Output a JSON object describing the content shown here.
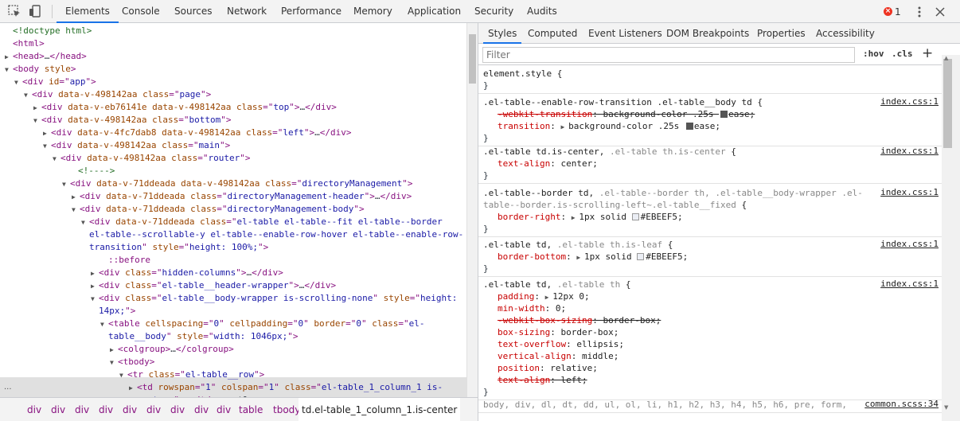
{
  "toolbar": {
    "tabs": [
      "Elements",
      "Console",
      "Sources",
      "Network",
      "Performance",
      "Memory",
      "Application",
      "Security",
      "Audits"
    ],
    "active_tab": "Elements",
    "error_count": "1",
    "icons": [
      "inspect-element-icon",
      "device-toggle-icon",
      "error-icon",
      "kebab-menu-icon",
      "close-icon"
    ]
  },
  "dom_lines": [
    {
      "parts": [
        [
          "cm",
          "<!doctype html>"
        ]
      ]
    },
    {
      "parts": [
        [
          "tag",
          "<html>"
        ]
      ]
    },
    {
      "tri": "▶",
      "parts": [
        [
          "tag",
          "<head>"
        ],
        [
          "plain",
          "…"
        ],
        [
          "tag",
          "</head>"
        ]
      ]
    },
    {
      "tri": "▼",
      "parts": [
        [
          "tag",
          "<body"
        ],
        [
          "an",
          " style"
        ],
        [
          "tag",
          ">"
        ]
      ]
    },
    {
      "tri": "▼",
      "parts": [
        [
          "tag",
          "<div"
        ],
        [
          "an",
          " id"
        ],
        [
          "tag",
          "=\""
        ],
        [
          "av",
          "app"
        ],
        [
          "tag",
          "\">"
        ]
      ]
    },
    {
      "tri": "▼",
      "parts": [
        [
          "tag",
          "<div"
        ],
        [
          "an",
          " data-v-498142aa class"
        ],
        [
          "tag",
          "=\""
        ],
        [
          "av",
          "page"
        ],
        [
          "tag",
          "\">"
        ]
      ]
    },
    {
      "tri": "▶",
      "parts": [
        [
          "tag",
          "<div"
        ],
        [
          "an",
          " data-v-eb76141e data-v-498142aa class"
        ],
        [
          "tag",
          "=\""
        ],
        [
          "av",
          "top"
        ],
        [
          "tag",
          "\">"
        ],
        [
          "plain",
          "…"
        ],
        [
          "tag",
          "</div>"
        ]
      ]
    },
    {
      "tri": "▼",
      "parts": [
        [
          "tag",
          "<div"
        ],
        [
          "an",
          " data-v-498142aa class"
        ],
        [
          "tag",
          "=\""
        ],
        [
          "av",
          "bottom"
        ],
        [
          "tag",
          "\">"
        ]
      ]
    },
    {
      "tri": "▶",
      "parts": [
        [
          "tag",
          "<div"
        ],
        [
          "an",
          " data-v-4fc7dab8 data-v-498142aa class"
        ],
        [
          "tag",
          "=\""
        ],
        [
          "av",
          "left"
        ],
        [
          "tag",
          "\">"
        ],
        [
          "plain",
          "…"
        ],
        [
          "tag",
          "</div>"
        ]
      ]
    },
    {
      "tri": "▼",
      "parts": [
        [
          "tag",
          "<div"
        ],
        [
          "an",
          " data-v-498142aa class"
        ],
        [
          "tag",
          "=\""
        ],
        [
          "av",
          "main"
        ],
        [
          "tag",
          "\">"
        ]
      ]
    },
    {
      "tri": "▼",
      "parts": [
        [
          "tag",
          "<div"
        ],
        [
          "an",
          " data-v-498142aa class"
        ],
        [
          "tag",
          "=\""
        ],
        [
          "av",
          "router"
        ],
        [
          "tag",
          "\">"
        ]
      ]
    },
    {
      "parts": [
        [
          "cm",
          "<!---->"
        ]
      ]
    },
    {
      "tri": "▼",
      "parts": [
        [
          "tag",
          "<div"
        ],
        [
          "an",
          " data-v-71ddeada data-v-498142aa class"
        ],
        [
          "tag",
          "=\""
        ],
        [
          "av",
          "directoryManagement"
        ],
        [
          "tag",
          "\">"
        ]
      ]
    },
    {
      "tri": "▶",
      "parts": [
        [
          "tag",
          "<div"
        ],
        [
          "an",
          " data-v-71ddeada class"
        ],
        [
          "tag",
          "=\""
        ],
        [
          "av",
          "directoryManagement-header"
        ],
        [
          "tag",
          "\">"
        ],
        [
          "plain",
          "…"
        ],
        [
          "tag",
          "</div>"
        ]
      ]
    },
    {
      "tri": "▼",
      "parts": [
        [
          "tag",
          "<div"
        ],
        [
          "an",
          " data-v-71ddeada class"
        ],
        [
          "tag",
          "=\""
        ],
        [
          "av",
          "directoryManagement-body"
        ],
        [
          "tag",
          "\">"
        ]
      ]
    },
    {
      "tri": "▼",
      "parts": [
        [
          "tag",
          "<div"
        ],
        [
          "an",
          " data-v-71ddeada class"
        ],
        [
          "tag",
          "=\""
        ],
        [
          "av",
          "el-table el-table--fit el-table--border"
        ]
      ]
    },
    {
      "parts": [
        [
          "av",
          "el-table--scrollable-y el-table--enable-row-hover el-table--enable-row-"
        ]
      ]
    },
    {
      "parts": [
        [
          "av",
          "transition"
        ],
        [
          "tag",
          "\""
        ],
        [
          "an",
          " style"
        ],
        [
          "tag",
          "=\""
        ],
        [
          "av",
          "height: 100%;"
        ],
        [
          "tag",
          "\">"
        ]
      ]
    },
    {
      "parts": [
        [
          "pseudo",
          "::before"
        ]
      ]
    },
    {
      "tri": "▶",
      "parts": [
        [
          "tag",
          "<div"
        ],
        [
          "an",
          " class"
        ],
        [
          "tag",
          "=\""
        ],
        [
          "av",
          "hidden-columns"
        ],
        [
          "tag",
          "\">"
        ],
        [
          "plain",
          "…"
        ],
        [
          "tag",
          "</div>"
        ]
      ]
    },
    {
      "tri": "▶",
      "parts": [
        [
          "tag",
          "<div"
        ],
        [
          "an",
          " class"
        ],
        [
          "tag",
          "=\""
        ],
        [
          "av",
          "el-table__header-wrapper"
        ],
        [
          "tag",
          "\">"
        ],
        [
          "plain",
          "…"
        ],
        [
          "tag",
          "</div>"
        ]
      ]
    },
    {
      "tri": "▼",
      "parts": [
        [
          "tag",
          "<div"
        ],
        [
          "an",
          " class"
        ],
        [
          "tag",
          "=\""
        ],
        [
          "av",
          "el-table__body-wrapper is-scrolling-none"
        ],
        [
          "tag",
          "\""
        ],
        [
          "an",
          " style"
        ],
        [
          "tag",
          "=\""
        ],
        [
          "av",
          "height:"
        ]
      ]
    },
    {
      "parts": [
        [
          "av",
          "14px;"
        ],
        [
          "tag",
          "\">"
        ]
      ]
    },
    {
      "tri": "▼",
      "parts": [
        [
          "tag",
          "<table"
        ],
        [
          "an",
          " cellspacing"
        ],
        [
          "tag",
          "=\""
        ],
        [
          "av",
          "0"
        ],
        [
          "tag",
          "\""
        ],
        [
          "an",
          " cellpadding"
        ],
        [
          "tag",
          "=\""
        ],
        [
          "av",
          "0"
        ],
        [
          "tag",
          "\""
        ],
        [
          "an",
          " border"
        ],
        [
          "tag",
          "=\""
        ],
        [
          "av",
          "0"
        ],
        [
          "tag",
          "\""
        ],
        [
          "an",
          " class"
        ],
        [
          "tag",
          "=\""
        ],
        [
          "av",
          "el-"
        ]
      ]
    },
    {
      "parts": [
        [
          "av",
          "table__body"
        ],
        [
          "tag",
          "\""
        ],
        [
          "an",
          " style"
        ],
        [
          "tag",
          "=\""
        ],
        [
          "av",
          "width: 1046px;"
        ],
        [
          "tag",
          "\">"
        ]
      ]
    },
    {
      "tri": "▶",
      "parts": [
        [
          "tag",
          "<colgroup>"
        ],
        [
          "plain",
          "…"
        ],
        [
          "tag",
          "</colgroup>"
        ]
      ]
    },
    {
      "tri": "▼",
      "parts": [
        [
          "tag",
          "<tbody>"
        ]
      ]
    },
    {
      "tri": "▼",
      "parts": [
        [
          "tag",
          "<tr"
        ],
        [
          "an",
          " class"
        ],
        [
          "tag",
          "=\""
        ],
        [
          "av",
          "el-table__row"
        ],
        [
          "tag",
          "\">"
        ]
      ]
    },
    {
      "tri": "▶",
      "parts": [
        [
          "tag",
          "<td"
        ],
        [
          "an",
          " rowspan"
        ],
        [
          "tag",
          "=\""
        ],
        [
          "av",
          "1"
        ],
        [
          "tag",
          "\""
        ],
        [
          "an",
          " colspan"
        ],
        [
          "tag",
          "=\""
        ],
        [
          "av",
          "1"
        ],
        [
          "tag",
          "\""
        ],
        [
          "an",
          " class"
        ],
        [
          "tag",
          "=\""
        ],
        [
          "av",
          "el-table_1_column_1 is-"
        ]
      ]
    },
    {
      "parts": [
        [
          "av",
          "center "
        ],
        [
          "tag",
          "\">"
        ],
        [
          "plain",
          "…"
        ],
        [
          "tag",
          "</td>"
        ],
        [
          "plain",
          " == $0"
        ]
      ]
    }
  ],
  "breadcrumbs": [
    "div",
    "div",
    "div",
    "div",
    "div",
    "div",
    "div",
    "div",
    "div",
    "table",
    "tbody",
    "tr",
    "td.el-table_1_column_1.is-center"
  ],
  "breadcrumb_dots": "...",
  "side_tabs": [
    "Styles",
    "Computed",
    "Event Listeners",
    "DOM Breakpoints",
    "Properties",
    "Accessibility"
  ],
  "active_side_tab": "Styles",
  "filter": {
    "placeholder": "Filter",
    "hov": ":hov",
    "cls": ".cls",
    "plus": "+"
  },
  "rules": [
    {
      "selector": [
        [
          "sel",
          "element.style {"
        ]
      ],
      "src": "",
      "props": [],
      "close": "}"
    },
    {
      "selector": [
        [
          "sel",
          ".el-table--enable-row-transition .el-table__body td {"
        ]
      ],
      "src": "index.css:1",
      "props": [
        {
          "name": "-webkit-transition",
          "value": "background-color .25s ease;",
          "strike": true,
          "ease": true
        },
        {
          "name": "transition",
          "value": "background-color .25s ease;",
          "strike": false,
          "tri": true,
          "ease": true
        }
      ],
      "close": "}"
    },
    {
      "selector": [
        [
          "sel",
          ".el-table td.is-center, "
        ],
        [
          "sel-dim",
          ".el-table th.is-center"
        ],
        [
          "sel",
          " {"
        ]
      ],
      "src": "index.css:1",
      "props": [
        {
          "name": "text-align",
          "value": "center;",
          "strike": false
        }
      ],
      "close": "}"
    },
    {
      "selector": [
        [
          "sel",
          ".el-table--border td, "
        ],
        [
          "sel-dim",
          ".el-table--border th, .el-table__body-wrapper .el-"
        ]
      ],
      "selector2": [
        [
          "sel-dim",
          "table--border.is-scrolling-left~.el-table__fixed"
        ],
        [
          "sel",
          " {"
        ]
      ],
      "src": "index.css:1",
      "props": [
        {
          "name": "border-right",
          "value": "1px solid #EBEEF5;",
          "strike": false,
          "tri": true,
          "swatch": "#EBEEF5"
        }
      ],
      "close": "}"
    },
    {
      "selector": [
        [
          "sel",
          ".el-table td, "
        ],
        [
          "sel-dim",
          ".el-table th.is-leaf"
        ],
        [
          "sel",
          " {"
        ]
      ],
      "src": "index.css:1",
      "props": [
        {
          "name": "border-bottom",
          "value": "1px solid #EBEEF5;",
          "strike": false,
          "tri": true,
          "swatch": "#EBEEF5"
        }
      ],
      "close": "}"
    },
    {
      "selector": [
        [
          "sel",
          ".el-table td, "
        ],
        [
          "sel-dim",
          ".el-table th"
        ],
        [
          "sel",
          " {"
        ]
      ],
      "src": "index.css:1",
      "props": [
        {
          "name": "padding",
          "value": "12px 0;",
          "strike": false,
          "tri": true
        },
        {
          "name": "min-width",
          "value": "0;",
          "strike": false
        },
        {
          "name": "-webkit-box-sizing",
          "value": "border-box;",
          "strike": true
        },
        {
          "name": "box-sizing",
          "value": "border-box;",
          "strike": false
        },
        {
          "name": "text-overflow",
          "value": "ellipsis;",
          "strike": false
        },
        {
          "name": "vertical-align",
          "value": "middle;",
          "strike": false
        },
        {
          "name": "position",
          "value": "relative;",
          "strike": false
        },
        {
          "name": "text-align",
          "value": "left;",
          "strike": true
        }
      ],
      "close": "}"
    },
    {
      "selector": [
        [
          "sel-dim",
          "body, div, dl, dt, dd, ul, ol, li, h1, h2, h3, h4, h5, h6, pre, form,"
        ]
      ],
      "src": "common.scss:34",
      "props": [],
      "close": ""
    }
  ],
  "colors": {
    "tab_active": "#1a73e8",
    "tag": "#881280",
    "attr_name": "#994500",
    "attr_value": "#1a1aa6",
    "prop_name": "#c80000",
    "error": "#ee3322"
  }
}
